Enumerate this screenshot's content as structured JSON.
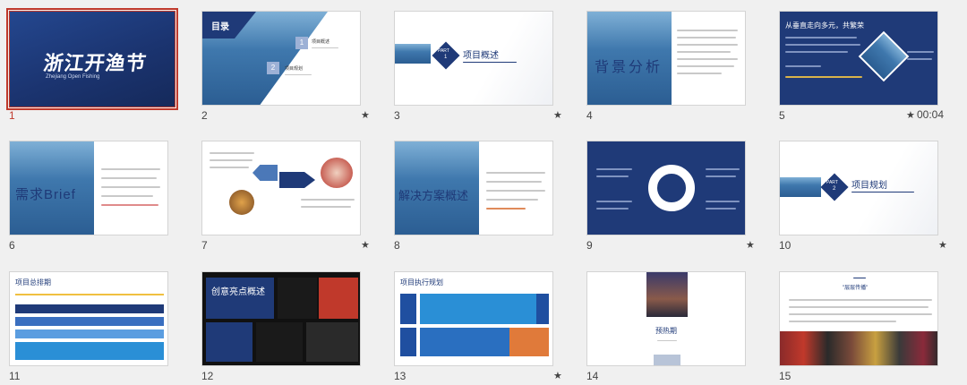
{
  "slides": [
    {
      "number": "1",
      "selected": true,
      "starred": false,
      "timing": "",
      "title": "浙江开渔节",
      "subtitle": "Zhejiang Open Fishing"
    },
    {
      "number": "2",
      "selected": false,
      "starred": true,
      "timing": "",
      "title": "目录",
      "items": [
        "项目概述",
        "项目规划"
      ]
    },
    {
      "number": "3",
      "selected": false,
      "starred": true,
      "timing": "",
      "title": "项目概述",
      "part": "PART",
      "part_num": "1"
    },
    {
      "number": "4",
      "selected": false,
      "starred": false,
      "timing": "",
      "title": "背景分析"
    },
    {
      "number": "5",
      "selected": false,
      "starred": true,
      "timing": "00:04",
      "title": "从垂直走向多元，共繁荣"
    },
    {
      "number": "6",
      "selected": false,
      "starred": false,
      "timing": "",
      "title": "需求Brief"
    },
    {
      "number": "7",
      "selected": false,
      "starred": true,
      "timing": "",
      "title": ""
    },
    {
      "number": "8",
      "selected": false,
      "starred": false,
      "timing": "",
      "title": "解决方案概述"
    },
    {
      "number": "9",
      "selected": false,
      "starred": true,
      "timing": "",
      "title": ""
    },
    {
      "number": "10",
      "selected": false,
      "starred": true,
      "timing": "",
      "title": "项目规划",
      "part": "PART",
      "part_num": "2"
    },
    {
      "number": "11",
      "selected": false,
      "starred": false,
      "timing": "",
      "title": "项目总排期"
    },
    {
      "number": "12",
      "selected": false,
      "starred": false,
      "timing": "",
      "title": "创意亮点概述"
    },
    {
      "number": "13",
      "selected": false,
      "starred": true,
      "timing": "",
      "title": "项目执行规划"
    },
    {
      "number": "14",
      "selected": false,
      "starred": false,
      "timing": "",
      "title": "预热期"
    },
    {
      "number": "15",
      "selected": false,
      "starred": false,
      "timing": "",
      "title": "\"层层传播\""
    }
  ],
  "star_glyph": "★"
}
